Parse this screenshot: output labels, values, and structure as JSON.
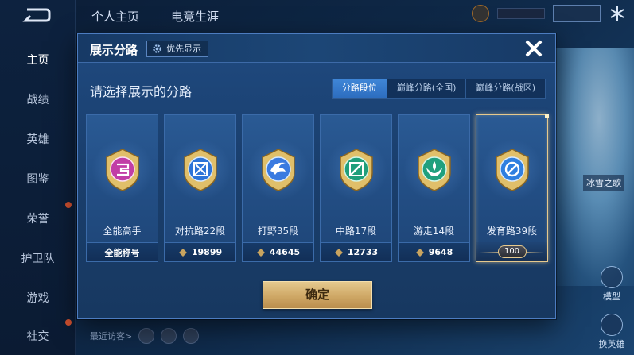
{
  "background": {
    "top_tabs": [
      "个人主页",
      "电竞生涯"
    ],
    "nav": [
      {
        "label": "主页",
        "active": true
      },
      {
        "label": "战绩",
        "active": false
      },
      {
        "label": "英雄",
        "active": false
      },
      {
        "label": "图鉴",
        "active": false
      },
      {
        "label": "荣誉",
        "active": false
      },
      {
        "label": "护卫队",
        "active": false
      },
      {
        "label": "游戏",
        "active": false
      },
      {
        "label": "社交",
        "active": false
      }
    ],
    "hero_label": "冰雪之歌",
    "side_buttons": [
      "模型",
      "换英雄"
    ],
    "visitors_label": "最近访客>"
  },
  "modal": {
    "title": "展示分路",
    "priority_label": "优先显示",
    "subtitle": "请选择展示的分路",
    "filter_tabs": [
      {
        "label": "分路段位",
        "active": true
      },
      {
        "label": "巅峰分路(全国)",
        "active": false
      },
      {
        "label": "巅峰分路(战区)",
        "active": false
      }
    ],
    "cards": [
      {
        "name": "全能高手",
        "footer": "全能称号",
        "color": "#c13ea6",
        "icon": "allround-emblem-icon"
      },
      {
        "name": "对抗路22段",
        "score": "19899",
        "color": "#2d74d8",
        "icon": "clash-lane-emblem-icon"
      },
      {
        "name": "打野35段",
        "score": "44645",
        "color": "#3a7ae0",
        "icon": "jungle-emblem-icon"
      },
      {
        "name": "中路17段",
        "score": "12733",
        "color": "#1f9e7a",
        "icon": "mid-lane-emblem-icon"
      },
      {
        "name": "游走14段",
        "score": "9648",
        "color": "#1fa07e",
        "icon": "roam-emblem-icon"
      },
      {
        "name": "发育路39段",
        "badge": "100",
        "color": "#2f7fe0",
        "icon": "farm-lane-emblem-icon",
        "selected": true
      }
    ],
    "confirm_label": "确定"
  },
  "colors": {
    "accent_gold": "#e6c98d",
    "active_tab": "#3a7fd2",
    "modal_bg": "#1c426f"
  }
}
